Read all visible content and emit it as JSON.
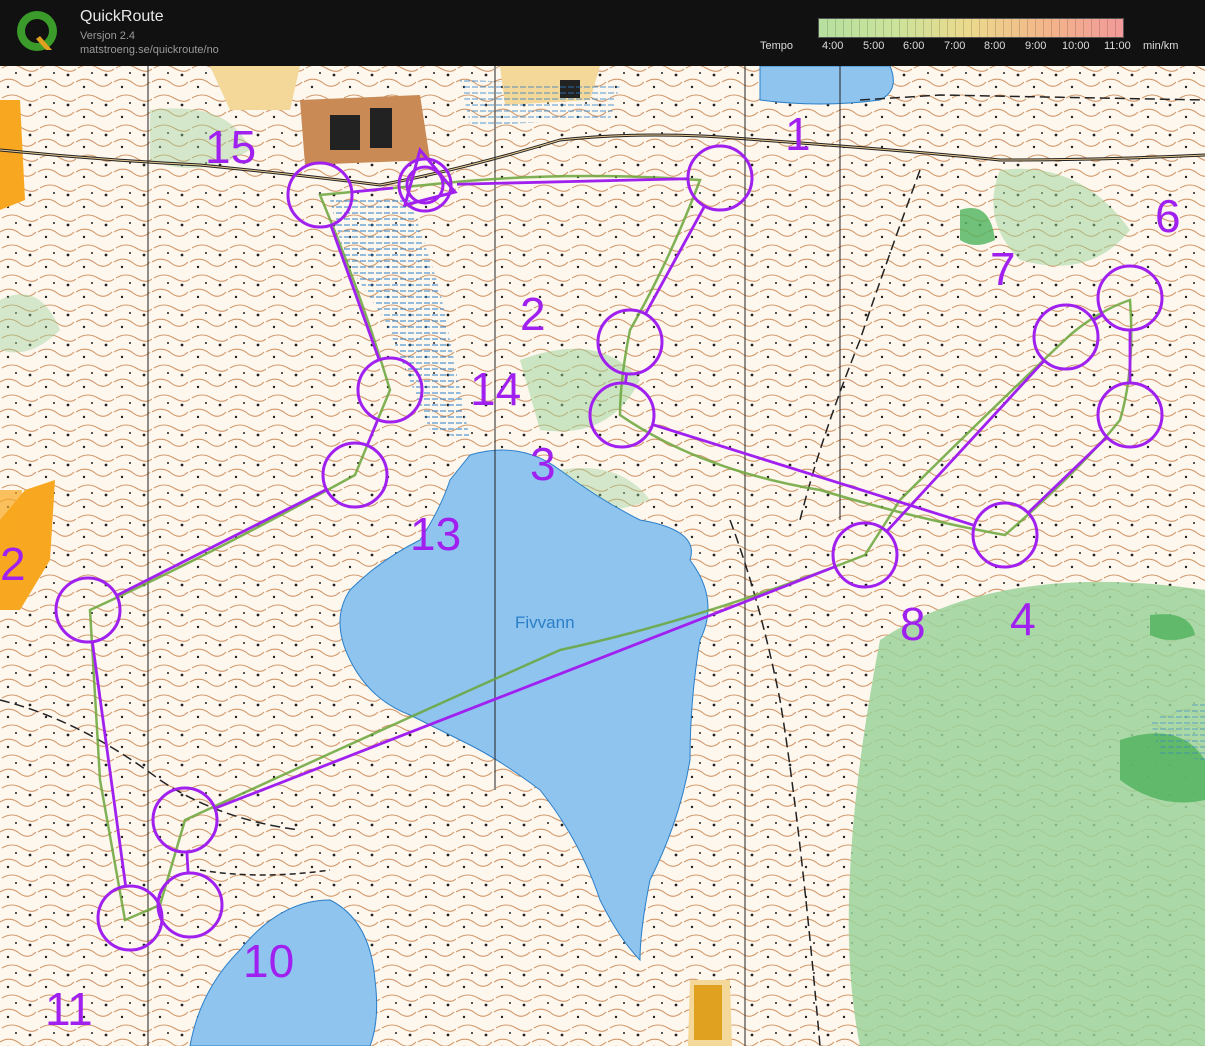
{
  "app": {
    "title": "QuickRoute",
    "version": "Versjon 2.4",
    "url": "matstroeng.se/quickroute/no"
  },
  "tempo": {
    "label": "Tempo",
    "ticks": [
      "4:00",
      "5:00",
      "6:00",
      "7:00",
      "8:00",
      "9:00",
      "10:00",
      "11:00"
    ],
    "unit": "min/km"
  },
  "map": {
    "lake_name": "Fivvann",
    "colors": {
      "course": "#a020f0",
      "water": "#8fc4ef",
      "terrain": "#fdf7ee",
      "contour": "#c2763c",
      "green": "#8fcf8a",
      "building": "#c98a55"
    },
    "controls": [
      {
        "label": "1"
      },
      {
        "label": "2"
      },
      {
        "label": "3"
      },
      {
        "label": "4"
      },
      {
        "label": "6"
      },
      {
        "label": "7"
      },
      {
        "label": "8"
      },
      {
        "label": "10"
      },
      {
        "label": "11"
      },
      {
        "label": "2"
      },
      {
        "label": "13"
      },
      {
        "label": "14"
      },
      {
        "label": "15"
      }
    ]
  }
}
